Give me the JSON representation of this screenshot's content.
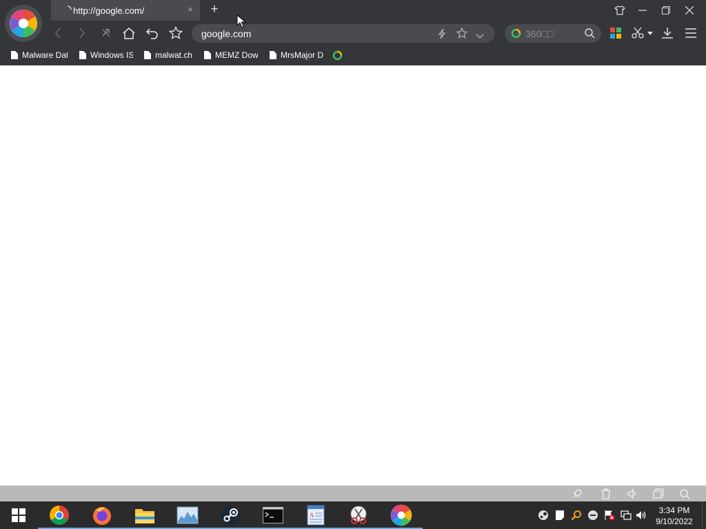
{
  "tab": {
    "title": "http://google.com/",
    "close_label": "×",
    "newtab_label": "+"
  },
  "address_bar": {
    "url": "google.com"
  },
  "search_box": {
    "placeholder": "360□□"
  },
  "bookmarks": [
    {
      "label": "Malware Dat"
    },
    {
      "label": "Windows IS"
    },
    {
      "label": "malwat.ch"
    },
    {
      "label": "MEMZ Dow"
    },
    {
      "label": "MrsMajor D"
    }
  ],
  "clock": {
    "time": "3:34 PM",
    "date": "9/10/2022"
  },
  "taskbar": {
    "apps": [
      "chrome-icon",
      "firefox-icon",
      "file-explorer-icon",
      "resource-monitor-icon",
      "steam-icon",
      "command-prompt-icon",
      "wordpad-icon",
      "snipping-tool-icon",
      "360-browser-icon"
    ]
  },
  "colors": {
    "chrome_bg": "#35363a",
    "tab_bg": "#4a4b4f",
    "taskbar_bg": "#2b2b2b",
    "statusbar_bg": "#b9b9b9",
    "page_bg": "#ffffff"
  }
}
